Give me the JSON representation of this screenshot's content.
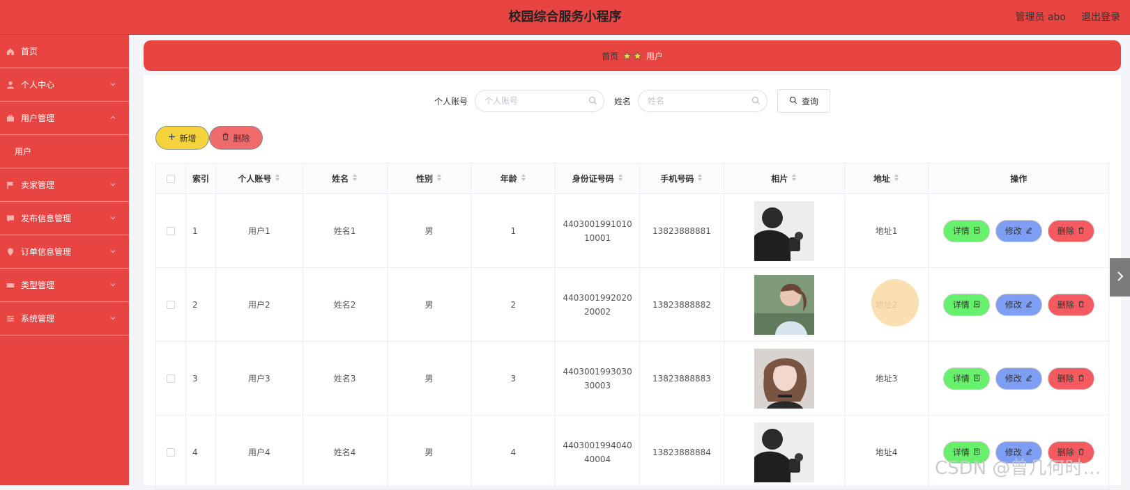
{
  "header": {
    "title": "校园综合服务小程序",
    "admin_label": "管理员 abo",
    "logout_label": "退出登录"
  },
  "sidebar": {
    "items": [
      {
        "label": "首页",
        "icon": "home-icon"
      },
      {
        "label": "个人中心",
        "icon": "user-icon",
        "chevron": "down"
      },
      {
        "label": "用户管理",
        "icon": "briefcase-icon",
        "chevron": "up"
      },
      {
        "label": "卖家管理",
        "icon": "flag-icon",
        "chevron": "down"
      },
      {
        "label": "发布信息管理",
        "icon": "chat-icon",
        "chevron": "down"
      },
      {
        "label": "订单信息管理",
        "icon": "location-icon",
        "chevron": "down"
      },
      {
        "label": "类型管理",
        "icon": "ticket-icon",
        "chevron": "down"
      },
      {
        "label": "系统管理",
        "icon": "sliders-icon",
        "chevron": "down"
      }
    ],
    "submenu": {
      "label": "用户"
    }
  },
  "breadcrumb": {
    "home": "首页",
    "current": "用户"
  },
  "search": {
    "account_label": "个人账号",
    "account_placeholder": "个人账号",
    "account_value": "",
    "name_label": "姓名",
    "name_placeholder": "姓名",
    "name_value": "",
    "query_label": "查询"
  },
  "actions": {
    "add_label": "新增",
    "delete_label": "删除"
  },
  "table": {
    "headers": {
      "index": "索引",
      "account": "个人账号",
      "name": "姓名",
      "gender": "性别",
      "age": "年龄",
      "idcard": "身份证号码",
      "phone": "手机号码",
      "photo": "相片",
      "address": "地址",
      "ops": "操作"
    },
    "rows": [
      {
        "index": "1",
        "account": "用户1",
        "name": "姓名1",
        "gender": "男",
        "age": "1",
        "idcard": "440300199101010001",
        "phone": "13823888881",
        "address": "地址1"
      },
      {
        "index": "2",
        "account": "用户2",
        "name": "姓名2",
        "gender": "男",
        "age": "2",
        "idcard": "440300199202020002",
        "phone": "13823888882",
        "address": "地址2"
      },
      {
        "index": "3",
        "account": "用户3",
        "name": "姓名3",
        "gender": "男",
        "age": "3",
        "idcard": "440300199303030003",
        "phone": "13823888883",
        "address": "地址3"
      },
      {
        "index": "4",
        "account": "用户4",
        "name": "姓名4",
        "gender": "男",
        "age": "4",
        "idcard": "440300199404040004",
        "phone": "13823888884",
        "address": "地址4"
      }
    ],
    "row_ops": {
      "detail": "详情",
      "edit": "修改",
      "delete": "删除"
    }
  },
  "watermark": "CSDN @曾几何时…",
  "colors": {
    "primary": "#e84441",
    "add_button": "#f5d33c",
    "delete_button": "#ef6b6b",
    "detail_button": "#67f06b",
    "edit_button": "#7e9ef4",
    "row_delete_button": "#f45a5f"
  }
}
